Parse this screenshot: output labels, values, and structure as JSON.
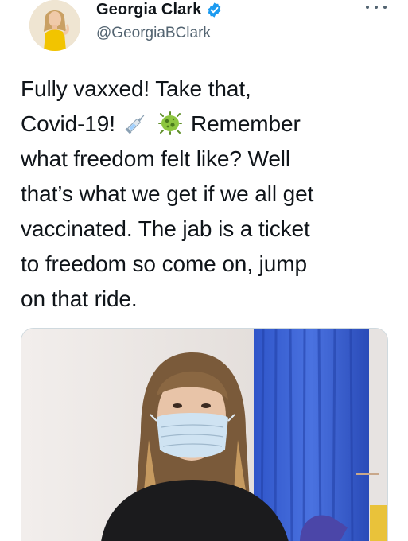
{
  "tweet": {
    "author_name": "Georgia Clark",
    "author_handle": "@GeorgiaBClark",
    "text_lines": [
      "Fully vaxxed! Take that,",
      "Covid-19!",
      "Remember",
      "what freedom felt like? Well",
      "that’s what we get if we all get",
      "vaccinated. The jab is a ticket",
      "to freedom so come on, jump",
      "on that ride."
    ]
  },
  "icons": {
    "verified": "verified-badge-icon",
    "more": "more-options-icon",
    "emoji_1": "syringe-emoji",
    "emoji_2": "microbe-emoji"
  },
  "colors": {
    "verified_blue": "#1d9bf0",
    "text": "#0f1419",
    "secondary_text": "#536471",
    "curtain_blue": "#3d62d6"
  }
}
